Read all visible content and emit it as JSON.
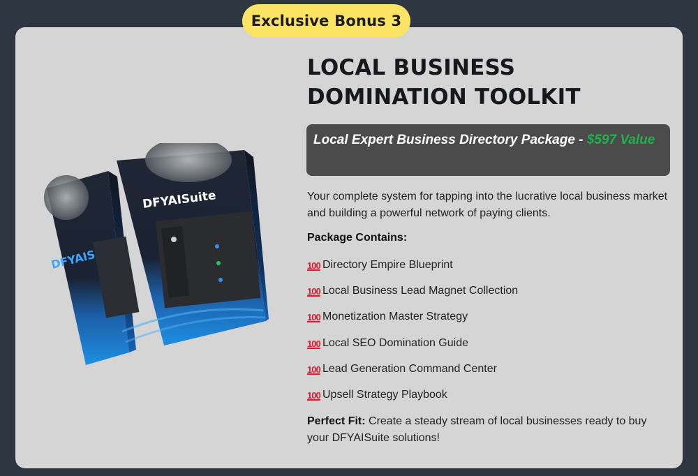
{
  "badge": {
    "label": "Exclusive Bonus 3"
  },
  "product": {
    "title": "LOCAL BUSINESS DOMINATION TOOLKIT",
    "subtitle_main": "Local Expert Business Directory Package - ",
    "subtitle_price": "$597",
    "subtitle_suffix": " Value",
    "description": "Your complete system for tapping into the lucrative local business market and building a powerful network of paying clients.",
    "package_heading": "Package Contains:",
    "items": [
      {
        "icon": "hundred-points-icon",
        "label": "Directory Empire Blueprint"
      },
      {
        "icon": "hundred-points-icon",
        "label": "Local Business Lead Magnet Collection"
      },
      {
        "icon": "hundred-points-icon",
        "label": "Monetization Master Strategy"
      },
      {
        "icon": "hundred-points-icon",
        "label": "Local SEO Domination Guide"
      },
      {
        "icon": "hundred-points-icon",
        "label": "Lead Generation Command Center"
      },
      {
        "icon": "hundred-points-icon",
        "label": "Upsell Strategy Playbook"
      }
    ],
    "perfect_fit_label": "Perfect Fit:",
    "perfect_fit_text": " Create a steady stream of local businesses ready to buy your DFYAISuite solutions!"
  },
  "box_art": {
    "brand_text": "DFYAISuite"
  },
  "colors": {
    "background": "#2e3642",
    "card": "#d5d5d5",
    "badge": "#fbe364",
    "price": "#22b04c",
    "subtitle_bg": "#4b4b4b"
  }
}
